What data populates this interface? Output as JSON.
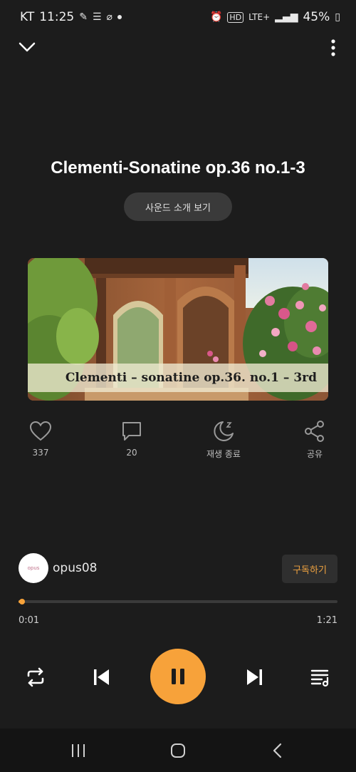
{
  "status_bar": {
    "carrier": "KT",
    "time": "11:25",
    "network": "LTE+",
    "battery": "45%"
  },
  "track": {
    "title": "Clementi-Sonatine op.36 no.1-3",
    "intro_label": "사운드 소개 보기",
    "cover_caption": "Clementi – sonatine op.36. no.1 – 3rd"
  },
  "actions": {
    "like_count": "337",
    "comment_count": "20",
    "sleep_label": "재생 종료",
    "share_label": "공유"
  },
  "channel": {
    "name": "opus08",
    "avatar_text": "opus",
    "subscribe_label": "구독하기"
  },
  "player": {
    "current_time": "0:01",
    "total_time": "1:21",
    "progress": 0.012,
    "state": "playing"
  },
  "icons": {
    "collapse": "chevron-down-icon",
    "more": "more-vertical-icon",
    "like": "heart-icon",
    "comment": "comment-icon",
    "sleep": "moon-icon",
    "share": "share-icon",
    "repeat": "repeat-icon",
    "previous": "skip-previous-icon",
    "pause": "pause-icon",
    "next": "skip-next-icon",
    "playlist": "playlist-icon"
  },
  "colors": {
    "accent": "#f7a23a",
    "background": "#1c1c1c"
  }
}
